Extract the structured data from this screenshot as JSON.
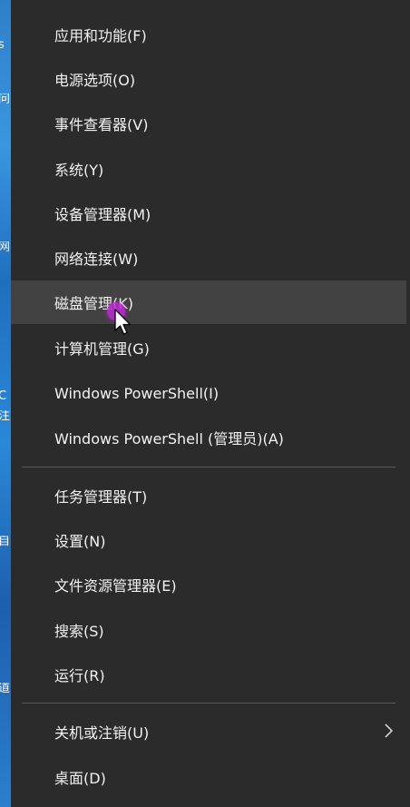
{
  "menu": {
    "items": [
      {
        "label": "应用和功能(F)"
      },
      {
        "label": "电源选项(O)"
      },
      {
        "label": "事件查看器(V)"
      },
      {
        "label": "系统(Y)"
      },
      {
        "label": "设备管理器(M)"
      },
      {
        "label": "网络连接(W)"
      },
      {
        "label": "磁盘管理(K)",
        "state": "hovered"
      },
      {
        "label": "计算机管理(G)"
      },
      {
        "label": "Windows PowerShell(I)"
      },
      {
        "label": "Windows PowerShell (管理员)(A)"
      },
      {
        "label": "任务管理器(T)"
      },
      {
        "label": "设置(N)"
      },
      {
        "label": "文件资源管理器(E)"
      },
      {
        "label": "搜索(S)"
      },
      {
        "label": "运行(R)"
      },
      {
        "label": "关机或注销(U)",
        "has_submenu": true
      },
      {
        "label": "桌面(D)"
      }
    ]
  },
  "desktop_strip": {
    "glyphs": [
      "s",
      "问",
      "网",
      "C",
      "注",
      "自",
      "道"
    ]
  },
  "colors": {
    "menu_bg": "#2b2b2b",
    "hover_bg": "#424242",
    "text": "#f2f2f2",
    "separator": "#5a5a5a",
    "click_marker": "#be28d2"
  },
  "icons": {
    "submenu": "chevron-right-icon",
    "pointer": "mouse-cursor-icon"
  }
}
